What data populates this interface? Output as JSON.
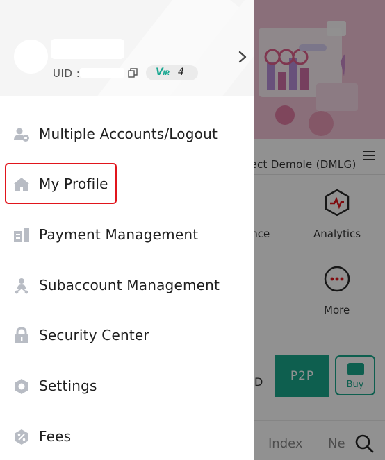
{
  "profile": {
    "uid_label": "UID :",
    "vip_mark": "V",
    "vip_mark_small": "IP.",
    "vip_level": "4"
  },
  "menu": [
    {
      "label": "Multiple Accounts/Logout",
      "icon": "user-switch-icon"
    },
    {
      "label": "My Profile",
      "icon": "home-icon"
    },
    {
      "label": "Payment Management",
      "icon": "payment-icon"
    },
    {
      "label": "Subaccount Management",
      "icon": "subaccount-icon"
    },
    {
      "label": "Security Center",
      "icon": "lock-icon"
    },
    {
      "label": "Settings",
      "icon": "settings-gear-icon"
    },
    {
      "label": "Fees",
      "icon": "fees-percent-icon"
    }
  ],
  "background": {
    "project_title": "ject Demole (DMLG)",
    "tiles": [
      {
        "label": "ance"
      },
      {
        "label": "Analytics",
        "icon": "analytics-icon"
      },
      {
        "label": "More",
        "icon": "more-icon"
      }
    ],
    "fiat_partial": "D",
    "p2p_label": "P2P",
    "buy_label": "Buy",
    "tabs": [
      {
        "label": "Index"
      },
      {
        "label": "Ne"
      }
    ]
  },
  "colors": {
    "accent_green": "#19a78c",
    "highlight_red": "#e1151c",
    "icon_gray": "#b8bcc4",
    "banner_pink": "#f2c4d6"
  }
}
